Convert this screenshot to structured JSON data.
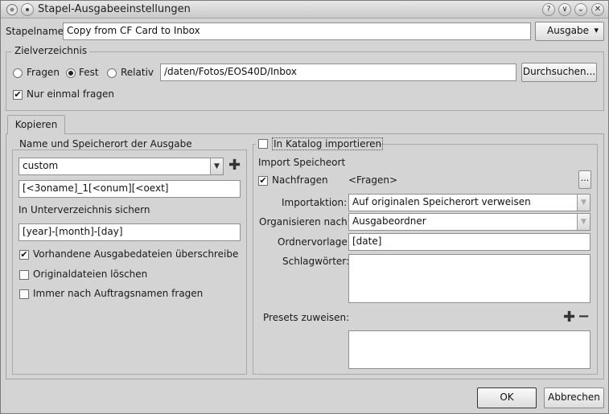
{
  "window": {
    "title": "Stapel-Ausgabeeinstellungen"
  },
  "titlebar_buttons": {
    "help": "?",
    "shade": "∨",
    "minimize": "⌄",
    "close": "✕"
  },
  "batch": {
    "name_label": "Stapelname",
    "name_value": "Copy from CF Card to Inbox",
    "output_button": "Ausgabe",
    "output_arrow": "▾"
  },
  "destination": {
    "group_title": "Zielverzeichnis",
    "radio_ask": "Fragen",
    "radio_fixed": "Fest",
    "radio_relative": "Relativ",
    "path_value": "/daten/Fotos/EOS40D/Inbox",
    "browse_button": "Durchsuchen...",
    "ask_once_label": "Nur einmal fragen",
    "ask_once_mark": "✔"
  },
  "tabs": {
    "copy": "Kopieren"
  },
  "output_name": {
    "group_title": "Name und Speicherort der Ausgabe",
    "preset_value": "custom",
    "combo_arrow": "▼",
    "add_icon": "✚",
    "pattern_value": "[<3oname]_1[<onum][<oext]",
    "subfolder_label": "In Unterverzeichnis sichern",
    "subfolder_value": "[year]-[month]-[day]",
    "overwrite_label": "Vorhandene Ausgabedateien überschreibe",
    "overwrite_mark": "✔",
    "delete_originals_label": "Originaldateien löschen",
    "ask_job_name_label": "Immer nach Auftragsnamen fragen"
  },
  "catalog": {
    "import_label": "In Katalog importieren",
    "import_location_title": "Import Speicheort",
    "ask_label": "Nachfragen",
    "ask_mark": "✔",
    "ask_value": "<Fragen>",
    "more_button": "...",
    "import_action_label": "Importaktion:",
    "import_action_value": "Auf originalen Speicherort verweisen",
    "organize_label": "Organisieren nach:",
    "organize_value": "Ausgabeordner",
    "folder_template_label": "Ordnervorlage:",
    "folder_template_value": "[date]",
    "keywords_label": "Schlagwörter:",
    "keywords_value": "",
    "presets_label": "Presets zuweisen:",
    "add_icon": "✚",
    "remove_icon": "−",
    "disabled_arrow": "▼"
  },
  "footer": {
    "ok": "OK",
    "cancel": "Abbrechen"
  }
}
